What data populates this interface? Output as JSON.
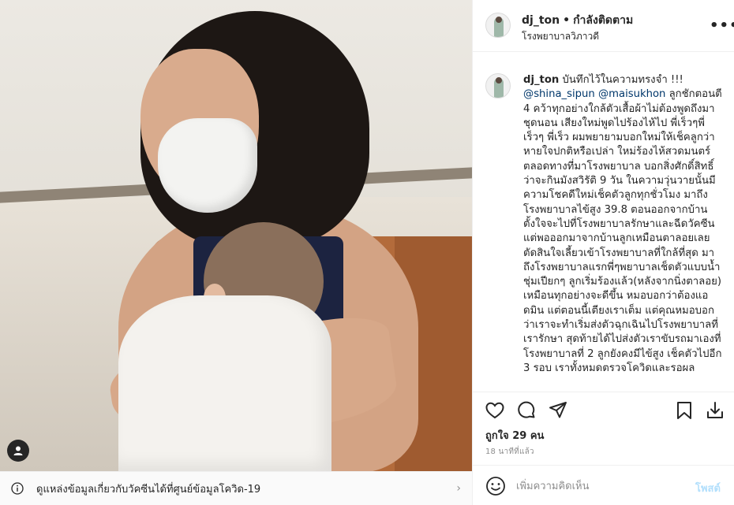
{
  "post": {
    "username": "dj_ton",
    "separator": "•",
    "follow_status": "กำลังติดตาม",
    "location": "โรงพยาบาลวิภาวดี"
  },
  "caption": {
    "username": "dj_ton",
    "intro": " บันทึกไว้ในความทรงจำ !!! ",
    "mention_1": "@shina_sipun",
    "space": " ",
    "mention_2": "@maisukhon",
    "text": " ลูกชักตอนตี 4 คว้าทุกอย่างใกล้ตัวเสื้อผ้าไม่ต้องพูดถึงมาชุดนอน เสียงใหม่พูดไปร้องไห้ไป พี่เร็วๆพี่เร็วๆ พี่เร็ว ผมพยายามบอกใหม่ให้เช็คลูกว่าหายใจปกติหรือเปล่า ใหม่ร้องไห้สวดมนตร์ตลอดทางที่มาโรงพยาบาล บอกสิ่งศักดิ์สิทธิ์ว่าจะกินมังสวิรัติ 9 วัน ในความวุ่นวายนั้นมีความโชคดีใหม่เช็คตัวลูกทุกชั่วโมง มาถึงโรงพยาบาลไข้สูง 39.8 ตอนออกจากบ้านตั้งใจจะไปที่โรงพยาบาลรักษาและฉีดวัคซีน แต่พอออกมาจากบ้านลูกเหมือนตาลอยเลยตัดสินใจเลี้ยวเข้าโรงพยาบาลที่ใกล้ที่สุด มาถึงโรงพยาบาลแรกพี่ๆพยาบาลเช็ดตัวแบบน้ำชุ่มเปียกๆ ลูกเริ่มร้องแล้ว(หลังจากนิ่งตาลอย) เหมือนทุกอย่างจะดีขึ้น หมอบอกว่าต้องแอดมิน แต่ตอนนี้เตียงเราเต็ม แต่คุณหมอบอกว่าเราจะทำเริ่มส่งตัวฉุกเฉินไปโรงพยาบาลที่เรารักษา สุดท้ายได้ไปส่งตัวเราขับรถมาเองที่โรงพยาบาลที่ 2 ลูกยังคงมีไข้สูง เช็คตัวไปอีก 3 รอบ เราทั้งหมดตรวจโควิดและรอผล"
  },
  "likes_text": "ถูกใจ 29 คน",
  "time_ago": "18 นาทีที่แล้ว",
  "comment_box": {
    "placeholder": "เพิ่มความคิดเห็น",
    "post_label": "โพสต์"
  },
  "vaccine_banner": {
    "text": "ดูแหล่งข้อมูลเกี่ยวกับวัคซีนได้ที่ศูนย์ข้อมูลโควิด-19",
    "chevron": "›"
  },
  "icons": {
    "more": "•••",
    "like": "heart-icon",
    "comment": "comment-icon",
    "share": "paper-plane-icon",
    "save": "bookmark-icon",
    "download": "download-icon",
    "emoji": "smiley-icon",
    "tag": "user-tag-icon",
    "info": "info-icon"
  },
  "colors": {
    "link": "#00376b",
    "post_disabled": "#b2dffc",
    "muted": "#8e8e8e",
    "border": "#efefef"
  }
}
